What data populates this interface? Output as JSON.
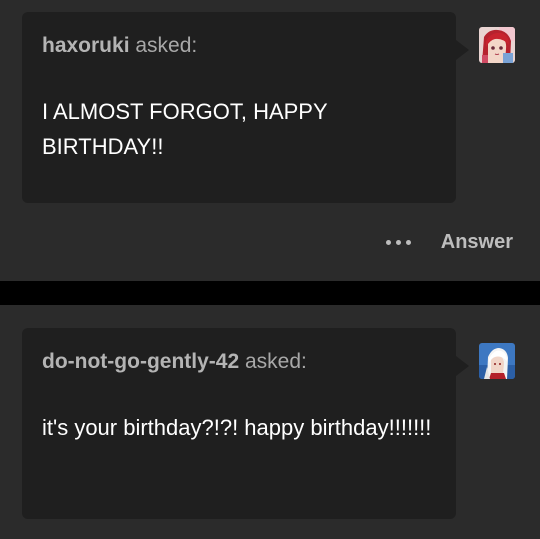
{
  "posts": [
    {
      "asker": "haxoruki",
      "asked_label": "asked:",
      "question": "I ALMOST FORGOT, HAPPY BIRTHDAY!!",
      "avatar": "anime-girl-red-hair-avatar"
    },
    {
      "asker": "do-not-go-gently-42",
      "asked_label": "asked:",
      "question": "it's your birthday?!?! happy birthday!!!!!!!",
      "avatar": "anime-character-white-hair-avatar"
    }
  ],
  "footer": {
    "more_icon": "more-options-icon",
    "answer_label": "Answer"
  },
  "colors": {
    "page_background": "#000000",
    "post_background": "#2b2b2b",
    "bubble_background": "#1f1f1f",
    "question_text": "#ffffff",
    "asker_text": "#b4b4b4"
  }
}
